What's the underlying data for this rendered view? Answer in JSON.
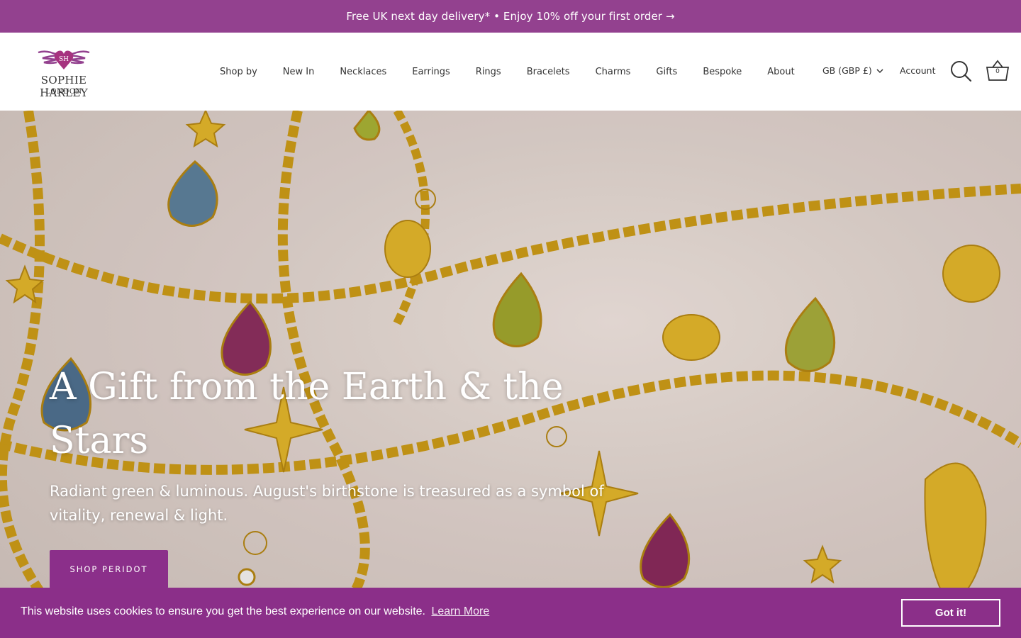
{
  "announcement": {
    "text": "Free UK next day delivery* • Enjoy 10% off your first order →"
  },
  "brand": {
    "monogram": "SH",
    "name": "SOPHIE HARLEY",
    "city": "LONDON",
    "accent": "#93418f"
  },
  "nav": {
    "items": [
      {
        "label": "Shop by"
      },
      {
        "label": "New In"
      },
      {
        "label": "Necklaces"
      },
      {
        "label": "Earrings"
      },
      {
        "label": "Rings"
      },
      {
        "label": "Bracelets"
      },
      {
        "label": "Charms"
      },
      {
        "label": "Gifts"
      },
      {
        "label": "Bespoke"
      },
      {
        "label": "About"
      }
    ]
  },
  "header_tools": {
    "locale": "GB (GBP £)",
    "account": "Account",
    "search_icon": "search-icon",
    "cart_icon": "basket-icon",
    "cart_count": "0"
  },
  "hero": {
    "title": "A Gift from the Earth & the Stars",
    "subtitle": "Radiant green & luminous. August's birthstone is treasured as a symbol of vitality, renewal & light.",
    "cta": "SHOP PERIDOT"
  },
  "cookie": {
    "message": "This website uses cookies to ensure you get the best experience on our website.",
    "learn_more": "Learn More",
    "accept": "Got it!",
    "color": "#8b2f89"
  }
}
